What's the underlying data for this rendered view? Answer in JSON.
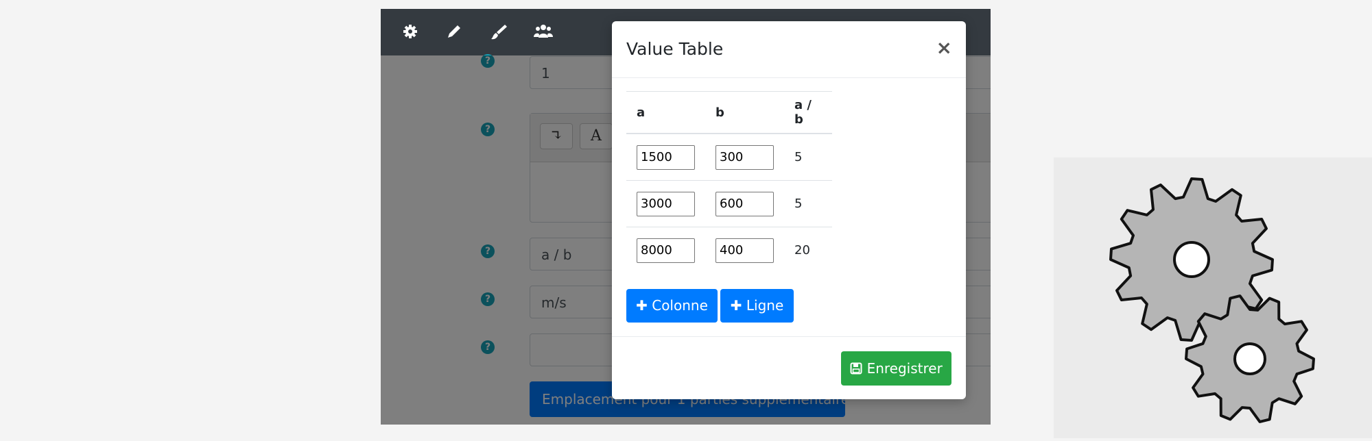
{
  "toolbar": {
    "icons": [
      "gear-icon",
      "pencil-icon",
      "brush-icon",
      "users-icon"
    ]
  },
  "form": {
    "help_icon_glyph": "?",
    "field1_value": "1",
    "editor_buttons": [
      "↴",
      "A"
    ],
    "formula_value": "a / b",
    "unit_value": "m/s",
    "field5_value": "",
    "extra_parts_button": "Emplacement pour 1 parties supplémentaires"
  },
  "modal": {
    "title": "Value Table",
    "close_glyph": "×",
    "table": {
      "headers": [
        "a",
        "b",
        "a / b"
      ],
      "rows": [
        {
          "a": "1500",
          "b": "300",
          "result": "5"
        },
        {
          "a": "3000",
          "b": "600",
          "result": "5"
        },
        {
          "a": "8000",
          "b": "400",
          "result": "20"
        }
      ]
    },
    "add_column_label": "Colonne",
    "add_row_label": "Ligne",
    "plus_glyph": "✚",
    "save_label": "Enregistrer",
    "save_icon": "save-icon"
  },
  "colors": {
    "primary": "#007bff",
    "success": "#28a745",
    "dark_bar": "#343a40",
    "info": "#17a2b8"
  },
  "decor": {
    "illustration": "gears-icon"
  }
}
